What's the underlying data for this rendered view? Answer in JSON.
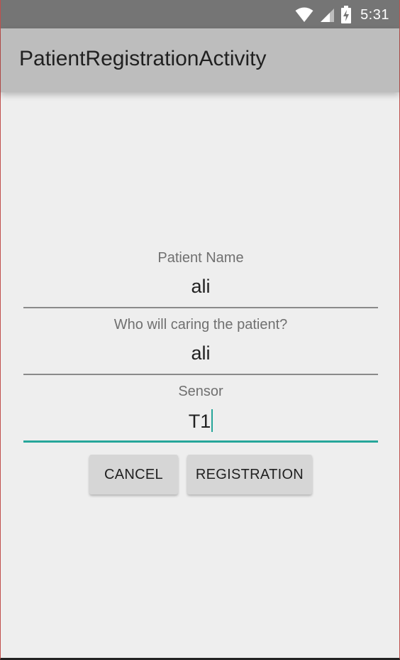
{
  "status_bar": {
    "time": "5:31",
    "icons": [
      "wifi-icon",
      "cell-signal-icon",
      "battery-charging-icon"
    ]
  },
  "app_bar": {
    "title": "PatientRegistrationActivity"
  },
  "form": {
    "fields": [
      {
        "label": "Patient Name",
        "value": "ali"
      },
      {
        "label": "Who will caring the patient?",
        "value": "ali"
      },
      {
        "label": "Sensor",
        "value": "T1"
      }
    ],
    "cancel_label": "CANCEL",
    "register_label": "REGISTRATION"
  },
  "colors": {
    "status_bar": "#757575",
    "app_bar": "#bdbdbd",
    "background": "#eeeeee",
    "accent": "#26a69a",
    "button": "#d6d6d6"
  }
}
